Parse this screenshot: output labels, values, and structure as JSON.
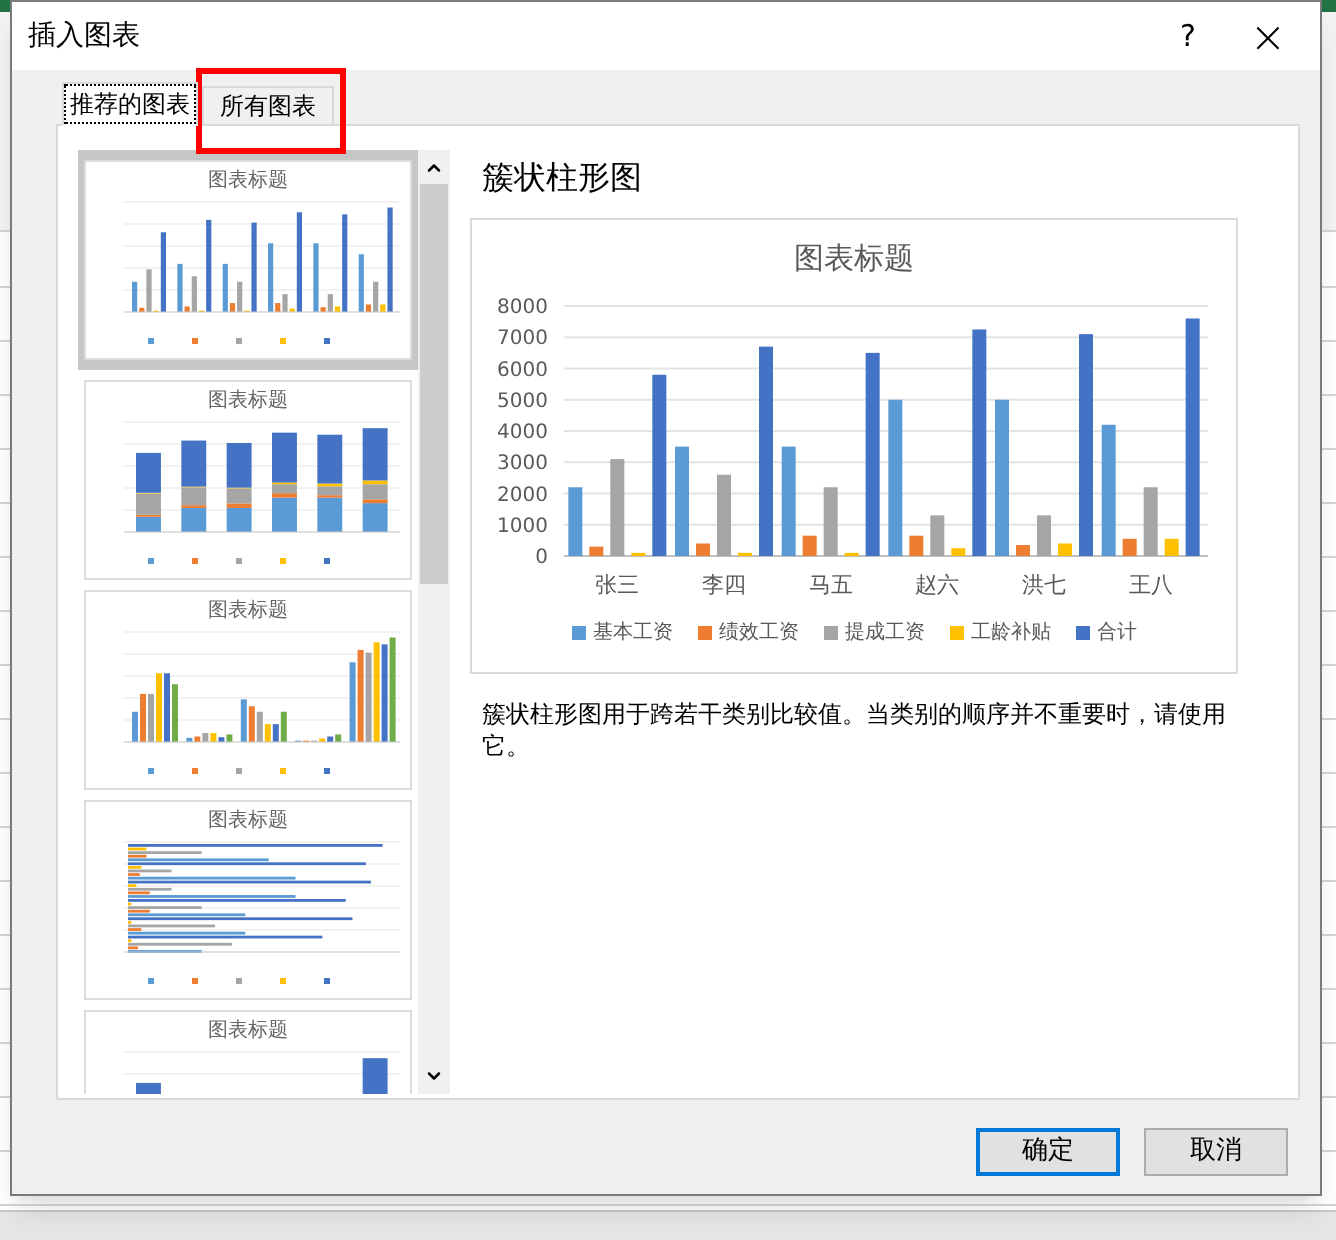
{
  "window": {
    "title": "插入图表",
    "help": "?",
    "close": "×"
  },
  "tabs": [
    {
      "label": "推荐的图表",
      "selected": true
    },
    {
      "label": "所有图表",
      "selected": false
    }
  ],
  "thumbnails": [
    {
      "kind": "clustered",
      "title": "图表标题",
      "selected": true
    },
    {
      "kind": "stacked",
      "title": "图表标题",
      "selected": false
    },
    {
      "kind": "by-series",
      "title": "图表标题",
      "selected": false
    },
    {
      "kind": "horizontal",
      "title": "图表标题",
      "selected": false
    },
    {
      "kind": "stacked-total",
      "title": "图表标题",
      "selected": false
    }
  ],
  "preview": {
    "heading": "簇状柱形图",
    "description": "簇状柱形图用于跨若干类别比较值。当类别的顺序并不重要时，请使用它。",
    "chart_data": {
      "type": "bar",
      "title": "图表标题",
      "categories": [
        "张三",
        "李四",
        "马五",
        "赵六",
        "洪七",
        "王八"
      ],
      "series": [
        {
          "name": "基本工资",
          "color": "#5b9bd5",
          "values": [
            2200,
            3500,
            3500,
            5000,
            5000,
            4200
          ]
        },
        {
          "name": "绩效工资",
          "color": "#ed7d31",
          "values": [
            300,
            400,
            650,
            650,
            350,
            550
          ]
        },
        {
          "name": "提成工资",
          "color": "#a5a5a5",
          "values": [
            3100,
            2600,
            2200,
            1300,
            1300,
            2200
          ]
        },
        {
          "name": "工龄补贴",
          "color": "#ffc000",
          "values": [
            100,
            100,
            100,
            250,
            400,
            550
          ]
        },
        {
          "name": "合计",
          "color": "#4472c4",
          "values": [
            5800,
            6700,
            6500,
            7250,
            7100,
            7600
          ]
        }
      ],
      "grid": true,
      "ylim": [
        0,
        8000
      ],
      "yticks": [
        0,
        1000,
        2000,
        3000,
        4000,
        5000,
        6000,
        7000,
        8000
      ]
    }
  },
  "buttons": [
    {
      "label": "确定",
      "selected": true
    },
    {
      "label": "取消",
      "selected": false
    }
  ]
}
